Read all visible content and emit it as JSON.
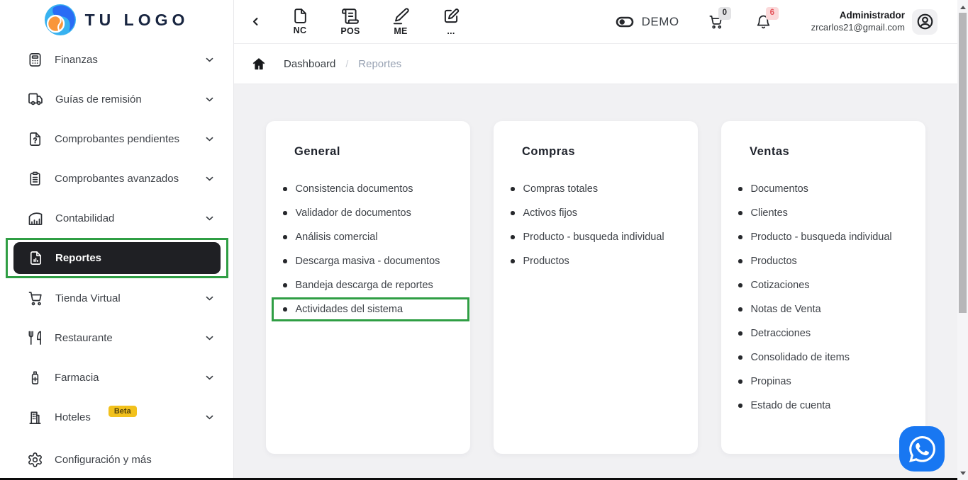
{
  "brand": {
    "name": "TU LOGO"
  },
  "sidebar": {
    "items": [
      {
        "id": "finanzas",
        "label": "Finanzas",
        "icon": "calculator-icon",
        "chevron": true
      },
      {
        "id": "guias-de-remision",
        "label": "Guías de remisión",
        "icon": "truck-icon",
        "chevron": true
      },
      {
        "id": "comprobantes-pendientes",
        "label": "Comprobantes pendientes",
        "icon": "file-question-icon",
        "chevron": true
      },
      {
        "id": "comprobantes-avanzados",
        "label": "Comprobantes avanzados",
        "icon": "clipboard-icon",
        "chevron": true
      },
      {
        "id": "contabilidad",
        "label": "Contabilidad",
        "icon": "chart-icon",
        "chevron": true
      },
      {
        "id": "reportes",
        "label": "Reportes",
        "icon": "file-chart-icon",
        "chevron": false,
        "active": true,
        "annotated": true
      },
      {
        "id": "tienda-virtual",
        "label": "Tienda Virtual",
        "icon": "cart-icon",
        "chevron": true
      },
      {
        "id": "restaurante",
        "label": "Restaurante",
        "icon": "utensils-icon",
        "chevron": true
      },
      {
        "id": "farmacia",
        "label": "Farmacia",
        "icon": "pharmacy-icon",
        "chevron": true
      },
      {
        "id": "hoteles",
        "label": "Hoteles",
        "icon": "building-icon",
        "chevron": true,
        "badge": "Beta"
      }
    ],
    "footer_item": {
      "id": "configuracion",
      "label": "Configuración y más",
      "icon": "gear-icon",
      "chevron": false
    }
  },
  "topbar": {
    "actions": [
      {
        "id": "nc",
        "label": "NC",
        "icon": "file-icon"
      },
      {
        "id": "pos",
        "label": "POS",
        "icon": "receipt-icon"
      },
      {
        "id": "me",
        "label": "ME",
        "icon": "pen-icon"
      },
      {
        "id": "more",
        "label": "...",
        "icon": "compose-icon"
      }
    ],
    "demo_label": "DEMO",
    "cart_badge": "0",
    "notifications_badge": "6",
    "user": {
      "name": "Administrador",
      "email": "zrcarlos21@gmail.com"
    }
  },
  "breadcrumb": {
    "separator": "/",
    "items": [
      {
        "label": "Dashboard",
        "current": false
      },
      {
        "label": "Reportes",
        "current": true
      }
    ]
  },
  "cards": [
    {
      "title": "General",
      "highlight_index": 5,
      "items": [
        "Consistencia documentos",
        "Validador de documentos",
        "Análisis comercial",
        "Descarga masiva - documentos",
        "Bandeja descarga de reportes",
        "Actividades del sistema"
      ]
    },
    {
      "title": "Compras",
      "highlight_index": null,
      "items": [
        "Compras totales",
        "Activos fijos",
        "Producto - busqueda individual",
        "Productos"
      ]
    },
    {
      "title": "Ventas",
      "highlight_index": null,
      "items": [
        "Documentos",
        "Clientes",
        "Producto - busqueda individual",
        "Productos",
        "Cotizaciones",
        "Notas de Venta",
        "Detracciones",
        "Consolidado de items",
        "Propinas",
        "Estado de cuenta"
      ]
    }
  ],
  "floating": {
    "whatsapp_icon": "whatsapp-icon"
  },
  "colors": {
    "annotation_green": "#2f9e44",
    "active_item_bg": "#1f2024",
    "whatsapp_blue": "#1877f2",
    "beta_badge_bg": "#f2c11c",
    "cart_badge_bg": "#e3e3e5",
    "notification_badge_bg": "#fbd9da",
    "notification_badge_text": "#e5555c"
  }
}
